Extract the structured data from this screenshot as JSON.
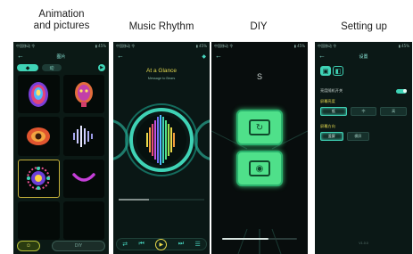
{
  "captions": {
    "animation": "Animation\nand pictures",
    "music": "Music Rhythm",
    "diy": "DIY",
    "setting": "Setting up"
  },
  "phones": {
    "animation": {
      "status_left": "中国移动 令",
      "status_right": "▮ 45%",
      "back": "←",
      "title": "图片",
      "tab_active_icon": "image-icon",
      "tab_inactive_label": "动",
      "bottom_left_label": "☺",
      "bottom_right_label": "DIY"
    },
    "music": {
      "status_left": "中国移动 令",
      "status_right": "▮ 45%",
      "back": "←",
      "title": "At a Glance",
      "subtitle": "Message to Bears"
    },
    "diy": {
      "status_left": "中国移动 令",
      "status_right": "▮ 45%",
      "back": "←",
      "logo": "S",
      "slider_value_fraction": 0.62
    },
    "setting": {
      "status_left": "中国移动 令",
      "status_right": "▮ 45%",
      "back": "←",
      "title": "设置",
      "toggle_label": "亮度随机开关",
      "section1_label": "屏幕亮度",
      "section1_options": [
        "低",
        "中",
        "高"
      ],
      "section2_label": "屏幕方向",
      "section2_options": [
        "竖屏",
        "横屏"
      ],
      "footer": "V1.0.0"
    }
  },
  "colors": {
    "accent_cyan": "#3fd3b6",
    "accent_yellow": "#e4d94e",
    "accent_green": "#4fe08a",
    "bg_dark": "#0a1512"
  }
}
